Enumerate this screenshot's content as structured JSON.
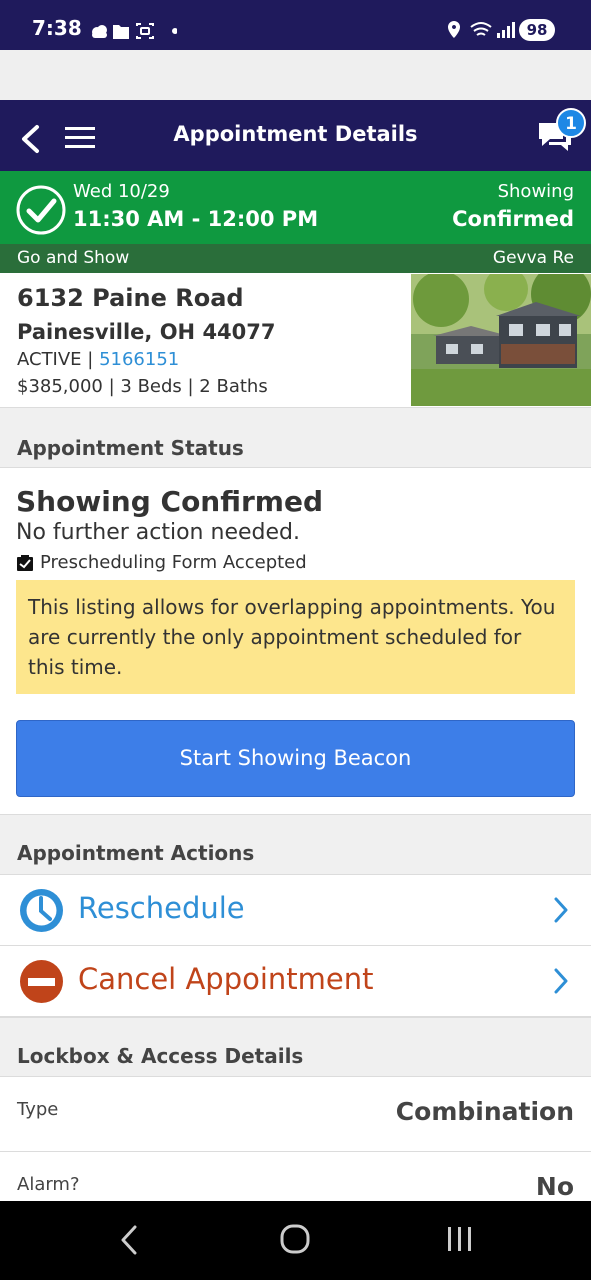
{
  "status_bar": {
    "time": "7:38",
    "battery": "98"
  },
  "header": {
    "title": "Appointment Details",
    "messages_count": "1"
  },
  "banner": {
    "date": "Wed 10/29",
    "time_range": "11:30 AM - 12:00 PM",
    "status_line1": "Showing",
    "status_line2": "Confirmed",
    "type": "Go and Show",
    "agent": "Gevva Re"
  },
  "property": {
    "address": "6132 Paine Road",
    "city": "Painesville, OH 44077",
    "status": "ACTIVE",
    "separator": " | ",
    "mls": "5166151",
    "details": "$385,000 | 3 Beds | 2 Baths"
  },
  "appointment_status": {
    "section_title": "Appointment Status",
    "heading": "Showing Confirmed",
    "subtext": "No further action needed.",
    "form_note": "Prescheduling Form Accepted",
    "overlap_note": "This listing allows for overlapping appointments. You are currently the only appointment scheduled for this time.",
    "beacon_button": "Start Showing Beacon"
  },
  "appointment_actions": {
    "section_title": "Appointment Actions",
    "reschedule": "Reschedule",
    "cancel": "Cancel Appointment"
  },
  "lockbox": {
    "section_title": "Lockbox & Access Details",
    "type_label": "Type",
    "type_value": "Combination",
    "alarm_label": "Alarm?",
    "alarm_value": "No"
  },
  "colors": {
    "header_bg": "#1f1a5c",
    "banner_green": "#0f9940",
    "subbanner_green": "#2a6e3a",
    "link_blue": "#2e8fd6",
    "cancel_red": "#c0441a",
    "note_yellow": "#fde68d",
    "button_blue": "#3d7ee8"
  },
  "icons": [
    "back-arrow-icon",
    "menu-icon",
    "chat-icon",
    "check-circle-icon",
    "clipboard-check-icon",
    "clock-icon",
    "no-entry-icon",
    "chevron-right-icon",
    "nav-back-icon",
    "nav-home-icon",
    "nav-recents-icon",
    "location-icon",
    "wifi-icon",
    "signal-icon",
    "weather-icon",
    "folder-icon",
    "screenshot-icon"
  ]
}
